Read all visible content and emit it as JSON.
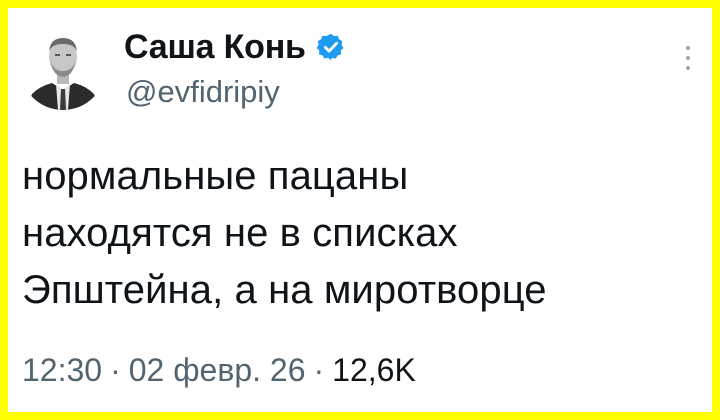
{
  "author": {
    "display_name": "Саша Конь",
    "handle": "@evfidripiy",
    "verified": true,
    "verified_color": "#1d9bf0",
    "avatar_icon": "profile-photo-man-in-suit"
  },
  "tweet": {
    "lines": [
      "нормальные пацаны",
      "находятся не в списках",
      "Эпштейна, а на миротворце"
    ]
  },
  "meta": {
    "time": "12:30",
    "separator": "·",
    "date": "02 февр. 26",
    "views": "12,6K"
  },
  "colors": {
    "frame": "#ffff00",
    "text_primary": "#0f1419",
    "text_secondary": "#536471"
  }
}
